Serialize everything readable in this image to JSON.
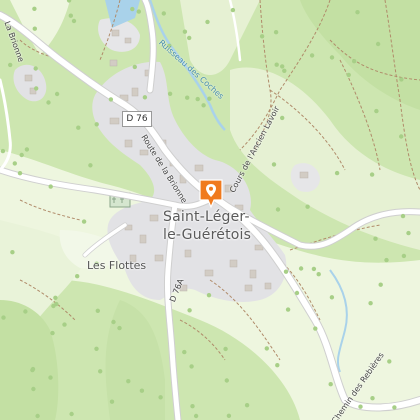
{
  "map": {
    "places": {
      "village_line1": "Saint-Léger-",
      "village_line2": "le-Guérétois",
      "hamlet": "Les Flottes"
    },
    "roads": {
      "shield": "D 76",
      "route_brionne": "Route de la Brionne",
      "cours_ancien": "Cours de l'Ancien Lavoir",
      "d76a": "D 76A",
      "chemin_rebieres": "Chemin des Rebières",
      "brionne_road": "La Brionne"
    },
    "water": {
      "stream": "Ruisseau des Coches"
    },
    "colors": {
      "forest": "#cde6b0",
      "meadow": "#f0f7e4",
      "settlement": "#e3e3e6",
      "water": "#a9d2ea",
      "road": "#ffffff",
      "marker": "#f07a1e"
    },
    "icons": {
      "marker": "map-pin-icon",
      "tree": "tree-icon"
    }
  }
}
